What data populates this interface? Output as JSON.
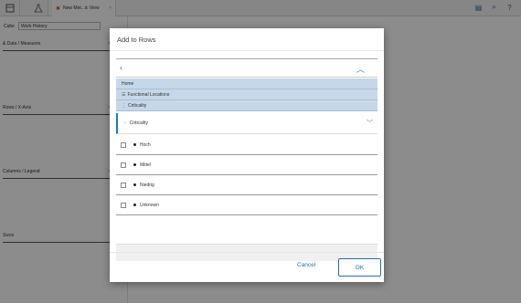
{
  "topbar": {
    "doc_tab_label": "New Met...ic View",
    "doc_tab_close": "×"
  },
  "left_panel": {
    "cube_label": "Cube",
    "cube_value": "Work History",
    "sections": [
      {
        "label": "& Data / Measures"
      },
      {
        "label": "Rows / X-Axis"
      },
      {
        "label": "Columns / Legend"
      },
      {
        "label": "Sizes"
      }
    ]
  },
  "dialog": {
    "title": "Add to Rows",
    "breadcrumbs": [
      {
        "label": "Home",
        "icon": ""
      },
      {
        "label": "Functional Locations",
        "icon": "list-icon"
      },
      {
        "label": "Criticality",
        "icon": "hierarchy-icon"
      }
    ],
    "selected": {
      "label": "Criticality"
    },
    "items": [
      {
        "label": "Hoch"
      },
      {
        "label": "Mittel"
      },
      {
        "label": "Niedrig"
      },
      {
        "label": "Unknown"
      }
    ],
    "cancel_label": "Cancel",
    "ok_label": "OK"
  },
  "colors": {
    "accent": "#2a6cb0",
    "breadcrumb_bg": "#c5d7e8",
    "selected_bar": "#1b7bbf",
    "overlay": "rgba(0,0,0,0.45)"
  }
}
